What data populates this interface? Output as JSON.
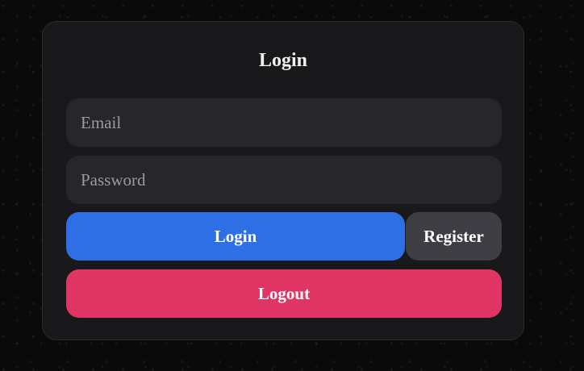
{
  "login_form": {
    "title": "Login",
    "email_placeholder": "Email",
    "email_value": "",
    "password_placeholder": "Password",
    "password_value": "",
    "login_label": "Login",
    "register_label": "Register",
    "logout_label": "Logout"
  },
  "colors": {
    "background": "#0a0a0a",
    "card": "#19191b",
    "input": "#27272a",
    "login_button": "#2f6fe6",
    "register_button": "#3f3e44",
    "logout_button": "#e03564"
  }
}
